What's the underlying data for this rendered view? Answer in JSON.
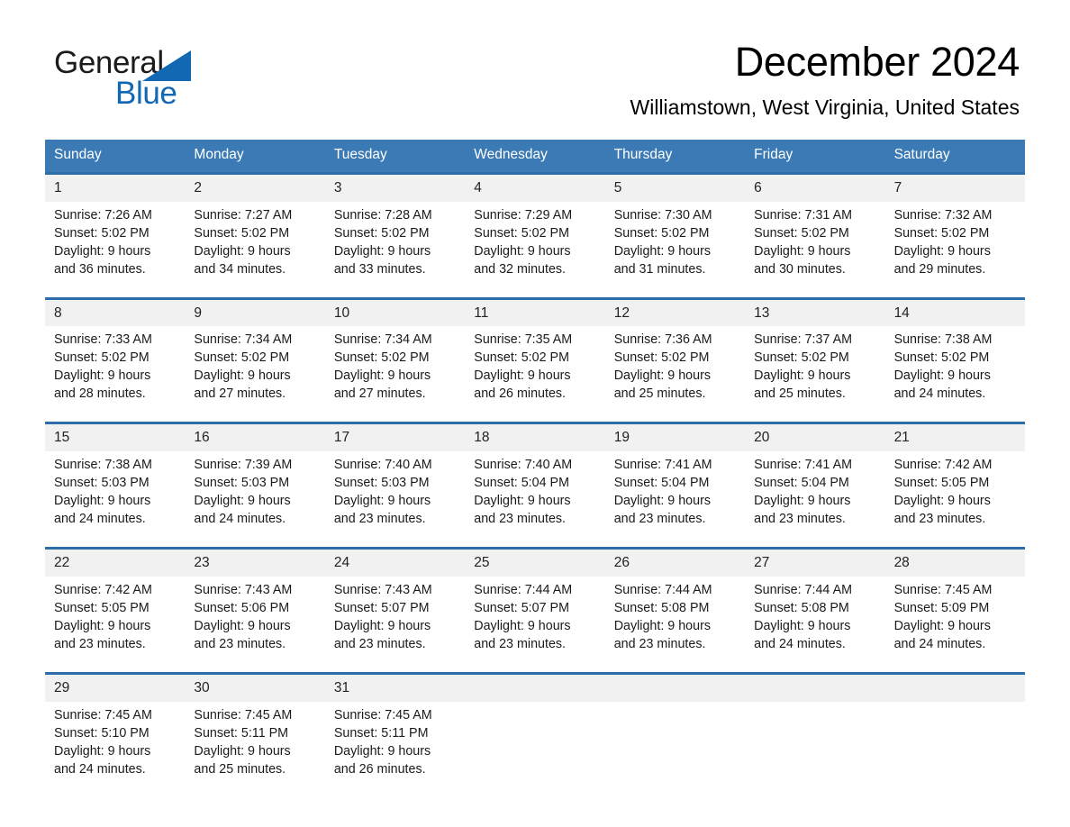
{
  "brand": {
    "name_part1": "General",
    "name_part2": "Blue",
    "logo_icon": "triangle-flag-icon",
    "accent_color": "#1268b3"
  },
  "header": {
    "month_title": "December 2024",
    "location": "Williamstown, West Virginia, United States"
  },
  "theme": {
    "header_blue": "#3b7ab5",
    "rule_blue": "#2f6da8",
    "daynum_band": "#f1f1f1",
    "text": "#1a1a1a"
  },
  "calendar": {
    "weekday_headers": [
      "Sunday",
      "Monday",
      "Tuesday",
      "Wednesday",
      "Thursday",
      "Friday",
      "Saturday"
    ],
    "weeks": [
      {
        "days": [
          {
            "date": "1",
            "sunrise": "Sunrise: 7:26 AM",
            "sunset": "Sunset: 5:02 PM",
            "daylight_line1": "Daylight: 9 hours",
            "daylight_line2": "and 36 minutes."
          },
          {
            "date": "2",
            "sunrise": "Sunrise: 7:27 AM",
            "sunset": "Sunset: 5:02 PM",
            "daylight_line1": "Daylight: 9 hours",
            "daylight_line2": "and 34 minutes."
          },
          {
            "date": "3",
            "sunrise": "Sunrise: 7:28 AM",
            "sunset": "Sunset: 5:02 PM",
            "daylight_line1": "Daylight: 9 hours",
            "daylight_line2": "and 33 minutes."
          },
          {
            "date": "4",
            "sunrise": "Sunrise: 7:29 AM",
            "sunset": "Sunset: 5:02 PM",
            "daylight_line1": "Daylight: 9 hours",
            "daylight_line2": "and 32 minutes."
          },
          {
            "date": "5",
            "sunrise": "Sunrise: 7:30 AM",
            "sunset": "Sunset: 5:02 PM",
            "daylight_line1": "Daylight: 9 hours",
            "daylight_line2": "and 31 minutes."
          },
          {
            "date": "6",
            "sunrise": "Sunrise: 7:31 AM",
            "sunset": "Sunset: 5:02 PM",
            "daylight_line1": "Daylight: 9 hours",
            "daylight_line2": "and 30 minutes."
          },
          {
            "date": "7",
            "sunrise": "Sunrise: 7:32 AM",
            "sunset": "Sunset: 5:02 PM",
            "daylight_line1": "Daylight: 9 hours",
            "daylight_line2": "and 29 minutes."
          }
        ]
      },
      {
        "days": [
          {
            "date": "8",
            "sunrise": "Sunrise: 7:33 AM",
            "sunset": "Sunset: 5:02 PM",
            "daylight_line1": "Daylight: 9 hours",
            "daylight_line2": "and 28 minutes."
          },
          {
            "date": "9",
            "sunrise": "Sunrise: 7:34 AM",
            "sunset": "Sunset: 5:02 PM",
            "daylight_line1": "Daylight: 9 hours",
            "daylight_line2": "and 27 minutes."
          },
          {
            "date": "10",
            "sunrise": "Sunrise: 7:34 AM",
            "sunset": "Sunset: 5:02 PM",
            "daylight_line1": "Daylight: 9 hours",
            "daylight_line2": "and 27 minutes."
          },
          {
            "date": "11",
            "sunrise": "Sunrise: 7:35 AM",
            "sunset": "Sunset: 5:02 PM",
            "daylight_line1": "Daylight: 9 hours",
            "daylight_line2": "and 26 minutes."
          },
          {
            "date": "12",
            "sunrise": "Sunrise: 7:36 AM",
            "sunset": "Sunset: 5:02 PM",
            "daylight_line1": "Daylight: 9 hours",
            "daylight_line2": "and 25 minutes."
          },
          {
            "date": "13",
            "sunrise": "Sunrise: 7:37 AM",
            "sunset": "Sunset: 5:02 PM",
            "daylight_line1": "Daylight: 9 hours",
            "daylight_line2": "and 25 minutes."
          },
          {
            "date": "14",
            "sunrise": "Sunrise: 7:38 AM",
            "sunset": "Sunset: 5:02 PM",
            "daylight_line1": "Daylight: 9 hours",
            "daylight_line2": "and 24 minutes."
          }
        ]
      },
      {
        "days": [
          {
            "date": "15",
            "sunrise": "Sunrise: 7:38 AM",
            "sunset": "Sunset: 5:03 PM",
            "daylight_line1": "Daylight: 9 hours",
            "daylight_line2": "and 24 minutes."
          },
          {
            "date": "16",
            "sunrise": "Sunrise: 7:39 AM",
            "sunset": "Sunset: 5:03 PM",
            "daylight_line1": "Daylight: 9 hours",
            "daylight_line2": "and 24 minutes."
          },
          {
            "date": "17",
            "sunrise": "Sunrise: 7:40 AM",
            "sunset": "Sunset: 5:03 PM",
            "daylight_line1": "Daylight: 9 hours",
            "daylight_line2": "and 23 minutes."
          },
          {
            "date": "18",
            "sunrise": "Sunrise: 7:40 AM",
            "sunset": "Sunset: 5:04 PM",
            "daylight_line1": "Daylight: 9 hours",
            "daylight_line2": "and 23 minutes."
          },
          {
            "date": "19",
            "sunrise": "Sunrise: 7:41 AM",
            "sunset": "Sunset: 5:04 PM",
            "daylight_line1": "Daylight: 9 hours",
            "daylight_line2": "and 23 minutes."
          },
          {
            "date": "20",
            "sunrise": "Sunrise: 7:41 AM",
            "sunset": "Sunset: 5:04 PM",
            "daylight_line1": "Daylight: 9 hours",
            "daylight_line2": "and 23 minutes."
          },
          {
            "date": "21",
            "sunrise": "Sunrise: 7:42 AM",
            "sunset": "Sunset: 5:05 PM",
            "daylight_line1": "Daylight: 9 hours",
            "daylight_line2": "and 23 minutes."
          }
        ]
      },
      {
        "days": [
          {
            "date": "22",
            "sunrise": "Sunrise: 7:42 AM",
            "sunset": "Sunset: 5:05 PM",
            "daylight_line1": "Daylight: 9 hours",
            "daylight_line2": "and 23 minutes."
          },
          {
            "date": "23",
            "sunrise": "Sunrise: 7:43 AM",
            "sunset": "Sunset: 5:06 PM",
            "daylight_line1": "Daylight: 9 hours",
            "daylight_line2": "and 23 minutes."
          },
          {
            "date": "24",
            "sunrise": "Sunrise: 7:43 AM",
            "sunset": "Sunset: 5:07 PM",
            "daylight_line1": "Daylight: 9 hours",
            "daylight_line2": "and 23 minutes."
          },
          {
            "date": "25",
            "sunrise": "Sunrise: 7:44 AM",
            "sunset": "Sunset: 5:07 PM",
            "daylight_line1": "Daylight: 9 hours",
            "daylight_line2": "and 23 minutes."
          },
          {
            "date": "26",
            "sunrise": "Sunrise: 7:44 AM",
            "sunset": "Sunset: 5:08 PM",
            "daylight_line1": "Daylight: 9 hours",
            "daylight_line2": "and 23 minutes."
          },
          {
            "date": "27",
            "sunrise": "Sunrise: 7:44 AM",
            "sunset": "Sunset: 5:08 PM",
            "daylight_line1": "Daylight: 9 hours",
            "daylight_line2": "and 24 minutes."
          },
          {
            "date": "28",
            "sunrise": "Sunrise: 7:45 AM",
            "sunset": "Sunset: 5:09 PM",
            "daylight_line1": "Daylight: 9 hours",
            "daylight_line2": "and 24 minutes."
          }
        ]
      },
      {
        "days": [
          {
            "date": "29",
            "sunrise": "Sunrise: 7:45 AM",
            "sunset": "Sunset: 5:10 PM",
            "daylight_line1": "Daylight: 9 hours",
            "daylight_line2": "and 24 minutes."
          },
          {
            "date": "30",
            "sunrise": "Sunrise: 7:45 AM",
            "sunset": "Sunset: 5:11 PM",
            "daylight_line1": "Daylight: 9 hours",
            "daylight_line2": "and 25 minutes."
          },
          {
            "date": "31",
            "sunrise": "Sunrise: 7:45 AM",
            "sunset": "Sunset: 5:11 PM",
            "daylight_line1": "Daylight: 9 hours",
            "daylight_line2": "and 26 minutes."
          },
          {
            "date": "",
            "sunrise": "",
            "sunset": "",
            "daylight_line1": "",
            "daylight_line2": ""
          },
          {
            "date": "",
            "sunrise": "",
            "sunset": "",
            "daylight_line1": "",
            "daylight_line2": ""
          },
          {
            "date": "",
            "sunrise": "",
            "sunset": "",
            "daylight_line1": "",
            "daylight_line2": ""
          },
          {
            "date": "",
            "sunrise": "",
            "sunset": "",
            "daylight_line1": "",
            "daylight_line2": ""
          }
        ]
      }
    ]
  }
}
